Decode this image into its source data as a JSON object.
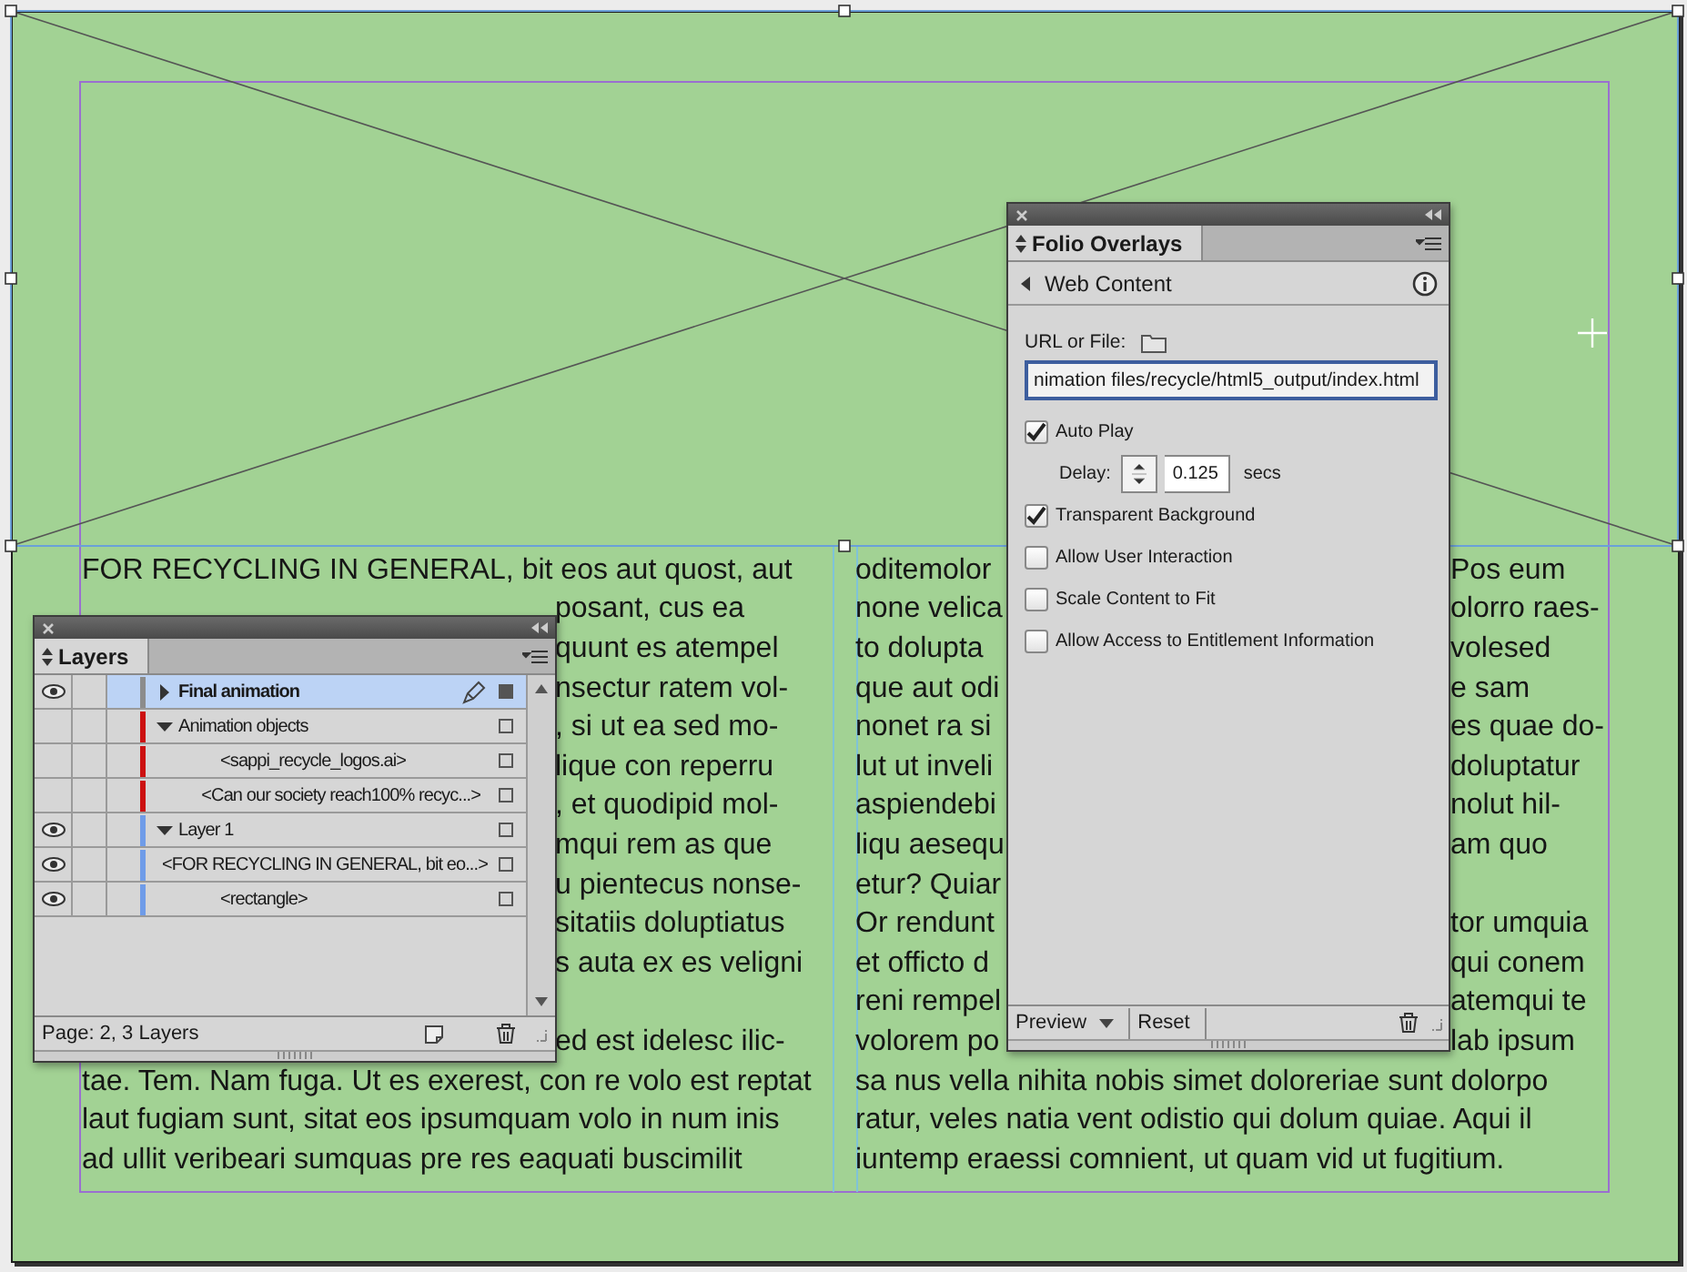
{
  "document": {
    "left_column": [
      {
        "full": "FOR RECYCLING IN GENERAL, bit eos aut quost, aut"
      },
      {
        "right": "posant, cus ea"
      },
      {
        "right": "quunt es atempel"
      },
      {
        "right": "nsectur ratem vol-"
      },
      {
        "right": ", si ut ea sed mo-"
      },
      {
        "right": "lique con reperru"
      },
      {
        "right": ", et quodipid mol-"
      },
      {
        "right": "mqui rem as que"
      },
      {
        "right": "u pientecus nonse-"
      },
      {
        "right": "sitatiis doluptiatus"
      },
      {
        "right": "s auta ex es veligni"
      },
      {
        "right": "ed est idelesc ilic-",
        "paragraph_start": true
      },
      {
        "full": "tae. Tem. Nam fuga. Ut es exerest, con re volo est reptat"
      },
      {
        "full": "laut fugiam sunt, sitat eos ipsumquam volo in num inis"
      },
      {
        "full": "ad ullit veribeari sumquas pre res eaquati buscimilit"
      }
    ],
    "right_column": [
      {
        "left": "oditemolor",
        "right": "Pos eum"
      },
      {
        "left": "none velica",
        "right": "olorro raes-"
      },
      {
        "left": "to dolupta",
        "right": "volesed"
      },
      {
        "left": "que aut odi",
        "right": "e sam"
      },
      {
        "left": "nonet ra si",
        "right": "es quae do-"
      },
      {
        "left": "lut ut inveli",
        "right": "doluptatur"
      },
      {
        "left": "aspiendebi",
        "right": "nolut hil-"
      },
      {
        "left": "liqu aesequ",
        "right": "am quo"
      },
      {
        "left": "etur? Quiar"
      },
      {
        "left": "Or rendunt",
        "right": "tor umquia"
      },
      {
        "left": "et officto d",
        "right": "qui conem"
      },
      {
        "left": "reni rempel",
        "right": "atemqui te"
      },
      {
        "left": "volorem po",
        "right": "lab ipsum"
      },
      {
        "full": "sa nus vella nihita nobis simet doloreriae sunt dolorpo"
      },
      {
        "full": "ratur, veles natia vent odistio qui dolum quiae. Aqui il"
      },
      {
        "full": "iuntemp eraessi comnient, ut quam vid ut fugitium."
      }
    ]
  },
  "layers_panel": {
    "tab": {
      "label": "Layers",
      "selected": true
    },
    "layers": [
      {
        "name": "Final animation",
        "visible": true,
        "color": "#8c8c8c",
        "selected": true,
        "expanded": false
      },
      {
        "name": "Animation objects",
        "visible": false,
        "color": "#cc1111",
        "selected": false,
        "expanded": true,
        "children": [
          {
            "name": "<sappi_recycle_logos.ai>",
            "visible": false,
            "color": "#cc1111",
            "selected": false
          },
          {
            "name": "<Can our society reach100% recyc...>",
            "visible": false,
            "color": "#cc1111",
            "selected": false
          }
        ]
      },
      {
        "name": "Layer 1",
        "visible": true,
        "color": "#6f9ce8",
        "selected": false,
        "expanded": true,
        "children": [
          {
            "name": "<FOR RECYCLING IN GENERAL, bit eo...>",
            "visible": true,
            "color": "#6f9ce8",
            "selected": false
          },
          {
            "name": "<rectangle>",
            "visible": true,
            "color": "#6f9ce8",
            "selected": false
          }
        ]
      }
    ],
    "footer": "Page: 2, 3 Layers"
  },
  "folio_panel": {
    "tab": {
      "label": "Folio Overlays",
      "selected": true
    },
    "section": "Web Content",
    "url_label": "URL or File:",
    "url_value": "nimation files/recycle/html5_output/index.html",
    "options": [
      {
        "kind": "checkbox",
        "label": "Auto Play",
        "checked": true
      },
      {
        "kind": "stepper",
        "label": "Delay:",
        "value": "0.125",
        "unit": "secs"
      },
      {
        "kind": "checkbox",
        "label": "Transparent Background",
        "checked": true
      },
      {
        "kind": "checkbox",
        "label": "Allow User Interaction",
        "checked": false
      },
      {
        "kind": "checkbox",
        "label": "Scale Content to Fit",
        "checked": false
      },
      {
        "kind": "checkbox",
        "label": "Allow Access to Entitlement Information",
        "checked": false
      }
    ],
    "buttons": [
      {
        "kind": "menu",
        "label": "Preview"
      },
      {
        "kind": "plain",
        "label": "Reset"
      }
    ]
  }
}
